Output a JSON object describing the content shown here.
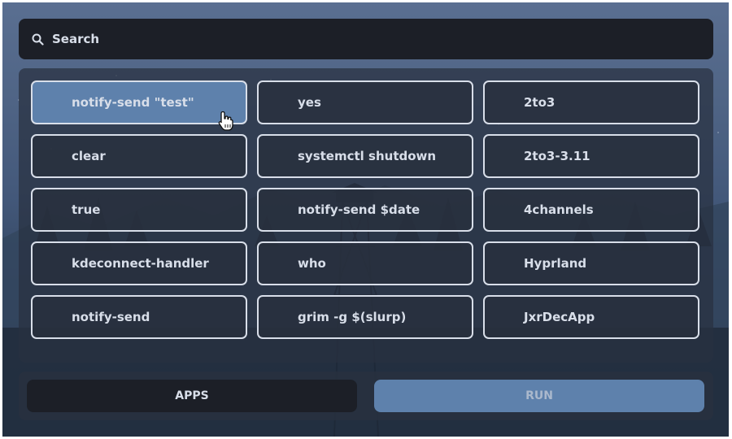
{
  "search": {
    "placeholder": "Search",
    "icon": "search-icon"
  },
  "grid": {
    "selected_index": 0,
    "columns": [
      [
        "notify-send \"test\"",
        "clear",
        "true",
        "kdeconnect-handler",
        "notify-send"
      ],
      [
        "yes",
        "systemctl shutdown",
        "notify-send $date",
        "who",
        "grim -g $(slurp)"
      ],
      [
        "2to3",
        "2to3-3.11",
        "4channels",
        "Hyprland",
        "JxrDecApp"
      ]
    ]
  },
  "buttons": {
    "apps_label": "APPS",
    "run_label": "RUN"
  },
  "colors": {
    "accent": "#5e81ac",
    "text": "#d8dee9",
    "dark": "#1c1f27"
  }
}
